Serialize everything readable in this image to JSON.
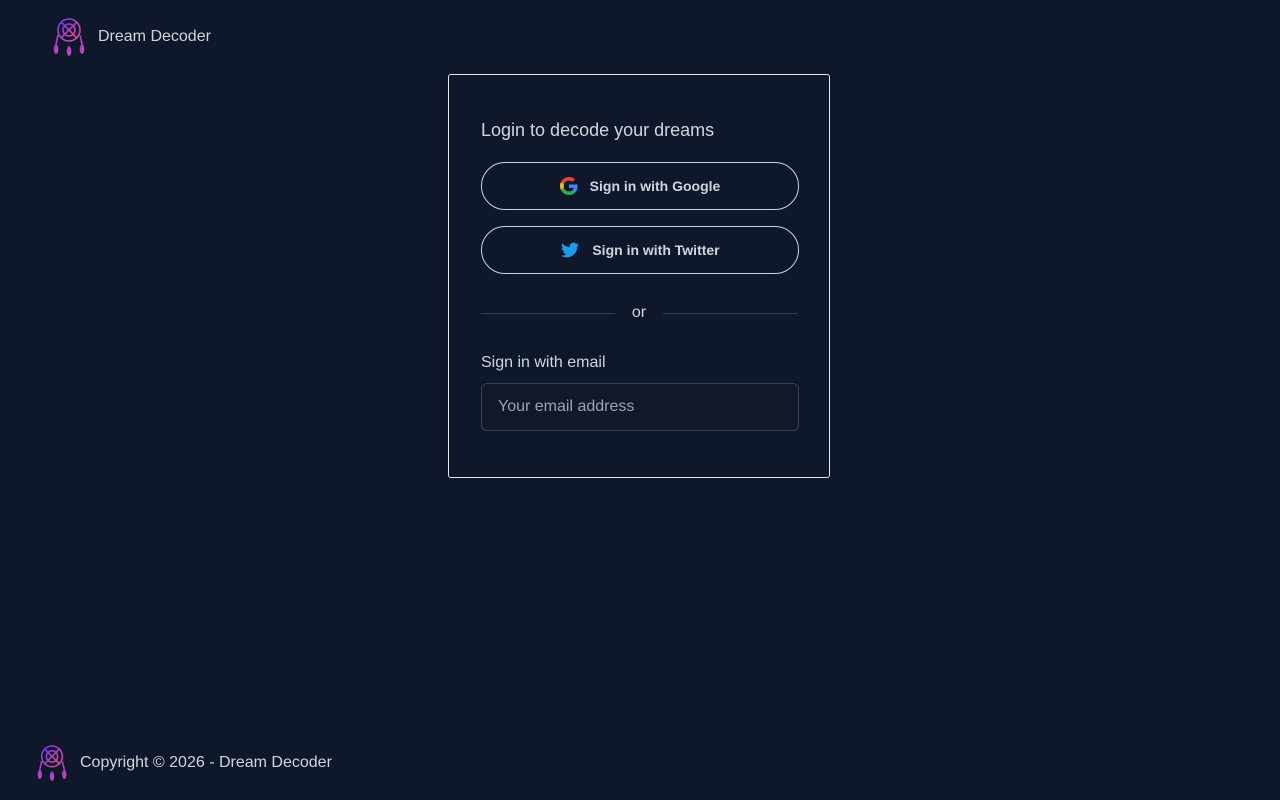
{
  "header": {
    "brand_name": "Dream Decoder",
    "logo_icon": "dreamcatcher-icon"
  },
  "login": {
    "title": "Login to decode your dreams",
    "google_label": "Sign in with Google",
    "twitter_label": "Sign in with Twitter",
    "divider_text": "or",
    "email_label": "Sign in with email",
    "email_placeholder": "Your email address",
    "email_value": ""
  },
  "footer": {
    "copyright": "Copyright © 2026 - Dream Decoder",
    "logo_icon": "dreamcatcher-icon"
  },
  "colors": {
    "background": "#0f172a",
    "text": "#d1d5db",
    "logo_gradient_start": "#7c3aed",
    "logo_gradient_end": "#ec4899",
    "twitter_blue": "#1d9bf0"
  }
}
